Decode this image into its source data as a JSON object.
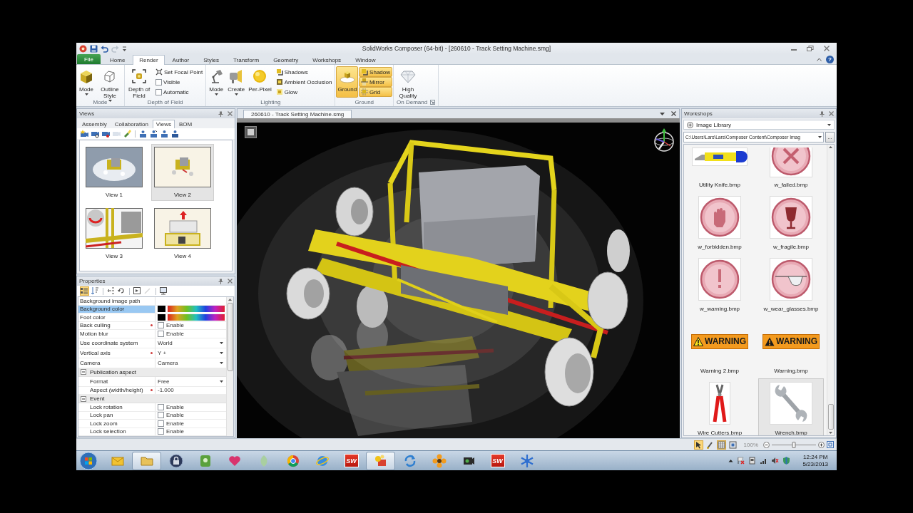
{
  "window": {
    "title": "SolidWorks Composer (64-bit) - [260610 - Track Setting Machine.smg]"
  },
  "ribbon": {
    "file": "File",
    "help": "?",
    "tabs": [
      {
        "label": "Home",
        "selected": false
      },
      {
        "label": "Render",
        "selected": true
      },
      {
        "label": "Author",
        "selected": false
      },
      {
        "label": "Styles",
        "selected": false
      },
      {
        "label": "Transform",
        "selected": false
      },
      {
        "label": "Geometry",
        "selected": false
      },
      {
        "label": "Workshops",
        "selected": false
      },
      {
        "label": "Window",
        "selected": false
      }
    ],
    "groups": [
      {
        "label": "Mode",
        "launcher": false,
        "large": [
          {
            "label": "Mode",
            "dropdown": true,
            "on": false
          },
          {
            "label": "Outline Style",
            "dropdown": true,
            "on": false
          }
        ]
      },
      {
        "label": "Depth of Field",
        "launcher": false,
        "large": [
          {
            "label": "Depth of Field",
            "dropdown": false,
            "on": false
          }
        ],
        "small": [
          {
            "kind": "button",
            "label": "Set Focal Point",
            "on": false
          },
          {
            "kind": "check",
            "label": "Visible",
            "checked": false
          },
          {
            "kind": "check",
            "label": "Automatic",
            "checked": false
          }
        ]
      },
      {
        "label": "Lighting",
        "launcher": false,
        "large": [
          {
            "label": "Mode",
            "dropdown": true,
            "on": false
          },
          {
            "label": "Create",
            "dropdown": true,
            "on": false
          },
          {
            "label": "Per-Pixel",
            "dropdown": false,
            "on": false
          }
        ],
        "small": [
          {
            "kind": "button",
            "label": "Shadows",
            "on": false
          },
          {
            "kind": "button",
            "label": "Ambient Occlusion",
            "on": false
          },
          {
            "kind": "button",
            "label": "Glow",
            "on": false
          }
        ]
      },
      {
        "label": "Ground",
        "launcher": false,
        "large": [
          {
            "label": "Ground",
            "dropdown": false,
            "on": true
          }
        ],
        "small": [
          {
            "kind": "button",
            "label": "Shadow",
            "on": true
          },
          {
            "kind": "button",
            "label": "Mirror",
            "on": true
          },
          {
            "kind": "button",
            "label": "Grid",
            "on": true
          }
        ]
      },
      {
        "label": "On Demand",
        "launcher": true,
        "large": [
          {
            "label": "High Quality",
            "dropdown": false,
            "on": false
          }
        ]
      }
    ]
  },
  "views_panel": {
    "title": "Views",
    "tabs": [
      {
        "label": "Assembly",
        "selected": false
      },
      {
        "label": "Collaboration",
        "selected": false
      },
      {
        "label": "Views",
        "selected": true
      },
      {
        "label": "BOM",
        "selected": false
      }
    ],
    "toolbar": [
      {
        "disabled": false
      },
      {
        "disabled": false
      },
      {
        "disabled": false
      },
      {
        "disabled": true
      },
      {
        "disabled": false
      },
      {
        "disabled": false
      },
      {
        "disabled": false
      },
      {
        "disabled": false
      },
      {
        "disabled": false
      }
    ],
    "views": [
      {
        "label": "View 1",
        "selected": false
      },
      {
        "label": "View 2",
        "selected": true
      },
      {
        "label": "View 3",
        "selected": false
      },
      {
        "label": "View 4",
        "selected": false
      }
    ]
  },
  "properties": {
    "title": "Properties",
    "toolbar": [
      {
        "on": true,
        "disabled": false
      },
      {
        "on": false,
        "disabled": false
      },
      {
        "on": false,
        "disabled": false
      },
      {
        "on": false,
        "disabled": false
      },
      {
        "on": false,
        "disabled": false
      },
      {
        "on": false,
        "disabled": true
      },
      {
        "on": false,
        "disabled": false
      }
    ],
    "rows": [
      {
        "kind": "text",
        "label": "Background image path",
        "selected": false,
        "modified": false
      },
      {
        "kind": "color",
        "label": "Background color",
        "color": "#000000",
        "selected": true,
        "modified": false
      },
      {
        "kind": "color",
        "label": "Foot color",
        "color": "#000000",
        "selected": false,
        "modified": false
      },
      {
        "kind": "checkbox",
        "label": "Back culling",
        "value": "Enable",
        "checked": false,
        "selected": false,
        "modified": true
      },
      {
        "kind": "checkbox",
        "label": "Motion blur",
        "value": "Enable",
        "checked": false,
        "selected": false,
        "modified": false
      },
      {
        "kind": "dropdown",
        "label": "Use coordinate system",
        "value": "World",
        "selected": false,
        "modified": false
      },
      {
        "kind": "dropdown",
        "label": "Vertical axis",
        "value": "Y +",
        "selected": false,
        "modified": true
      },
      {
        "kind": "dropdown",
        "label": "Camera",
        "value": "Camera",
        "selected": false,
        "modified": false
      },
      {
        "kind": "group",
        "label": "Publication aspect",
        "expanded": true,
        "selected": false,
        "children": [
          {
            "kind": "dropdown",
            "label": "Format",
            "value": "Free",
            "selected": false,
            "modified": false
          },
          {
            "kind": "text",
            "label": "Aspect (width/height)",
            "value": "-1.000",
            "selected": false,
            "modified": true
          }
        ]
      },
      {
        "kind": "group",
        "label": "Event",
        "expanded": true,
        "selected": false,
        "children": [
          {
            "kind": "checkbox",
            "label": "Lock rotation",
            "value": "Enable",
            "checked": false,
            "selected": false,
            "modified": false
          },
          {
            "kind": "checkbox",
            "label": "Lock pan",
            "value": "Enable",
            "checked": false,
            "selected": false,
            "modified": false
          },
          {
            "kind": "checkbox",
            "label": "Lock zoom",
            "value": "Enable",
            "checked": false,
            "selected": false,
            "modified": false
          },
          {
            "kind": "checkbox",
            "label": "Lock selection",
            "value": "Enable",
            "checked": false,
            "selected": false,
            "modified": false
          }
        ]
      }
    ]
  },
  "document": {
    "tab": "260610 - Track Setting Machine.smg"
  },
  "workshops": {
    "title": "Workshops",
    "library": "Image Library",
    "path": "C:\\Users\\Lars\\Lars\\Composer Content\\Composer Imag",
    "browse": "...",
    "images": [
      {
        "kind": "picture",
        "label": "Utility Knife.bmp",
        "selected": false
      },
      {
        "kind": "picture",
        "label": "w_failed.bmp",
        "selected": false
      },
      {
        "kind": "picture",
        "label": "w_forbidden.bmp",
        "selected": false
      },
      {
        "kind": "picture",
        "label": "w_fragile.bmp",
        "selected": false
      },
      {
        "kind": "picture",
        "label": "w_warning.bmp",
        "selected": false
      },
      {
        "kind": "picture",
        "label": "w_wear_glasses.bmp",
        "selected": false
      },
      {
        "kind": "sign",
        "text": "WARNING",
        "label": "Warning 2.bmp",
        "selected": false
      },
      {
        "kind": "sign",
        "text": "WARNING",
        "label": "Warning.bmp",
        "selected": false
      },
      {
        "kind": "picture",
        "label": "Wire Cutters.bmp",
        "selected": false
      },
      {
        "kind": "picture",
        "label": "Wrench.bmp",
        "selected": true
      }
    ]
  },
  "status_bar": {
    "tools": [
      {
        "on": true
      },
      {
        "on": false
      },
      {
        "on": true
      },
      {
        "on": false
      }
    ],
    "zoom": "100%",
    "level": 0.5
  },
  "taskbar": {
    "apps": [
      {
        "active": false
      },
      {
        "active": true
      },
      {
        "active": false
      },
      {
        "active": false
      },
      {
        "active": false
      },
      {
        "active": false
      },
      {
        "active": false
      },
      {
        "active": false
      },
      {
        "active": false,
        "text": "SW"
      },
      {
        "active": true
      },
      {
        "active": false
      },
      {
        "active": false
      },
      {
        "active": false
      },
      {
        "active": false,
        "text": "SW"
      },
      {
        "active": false
      }
    ],
    "time": "12:24 PM",
    "date": "5/23/2013"
  }
}
